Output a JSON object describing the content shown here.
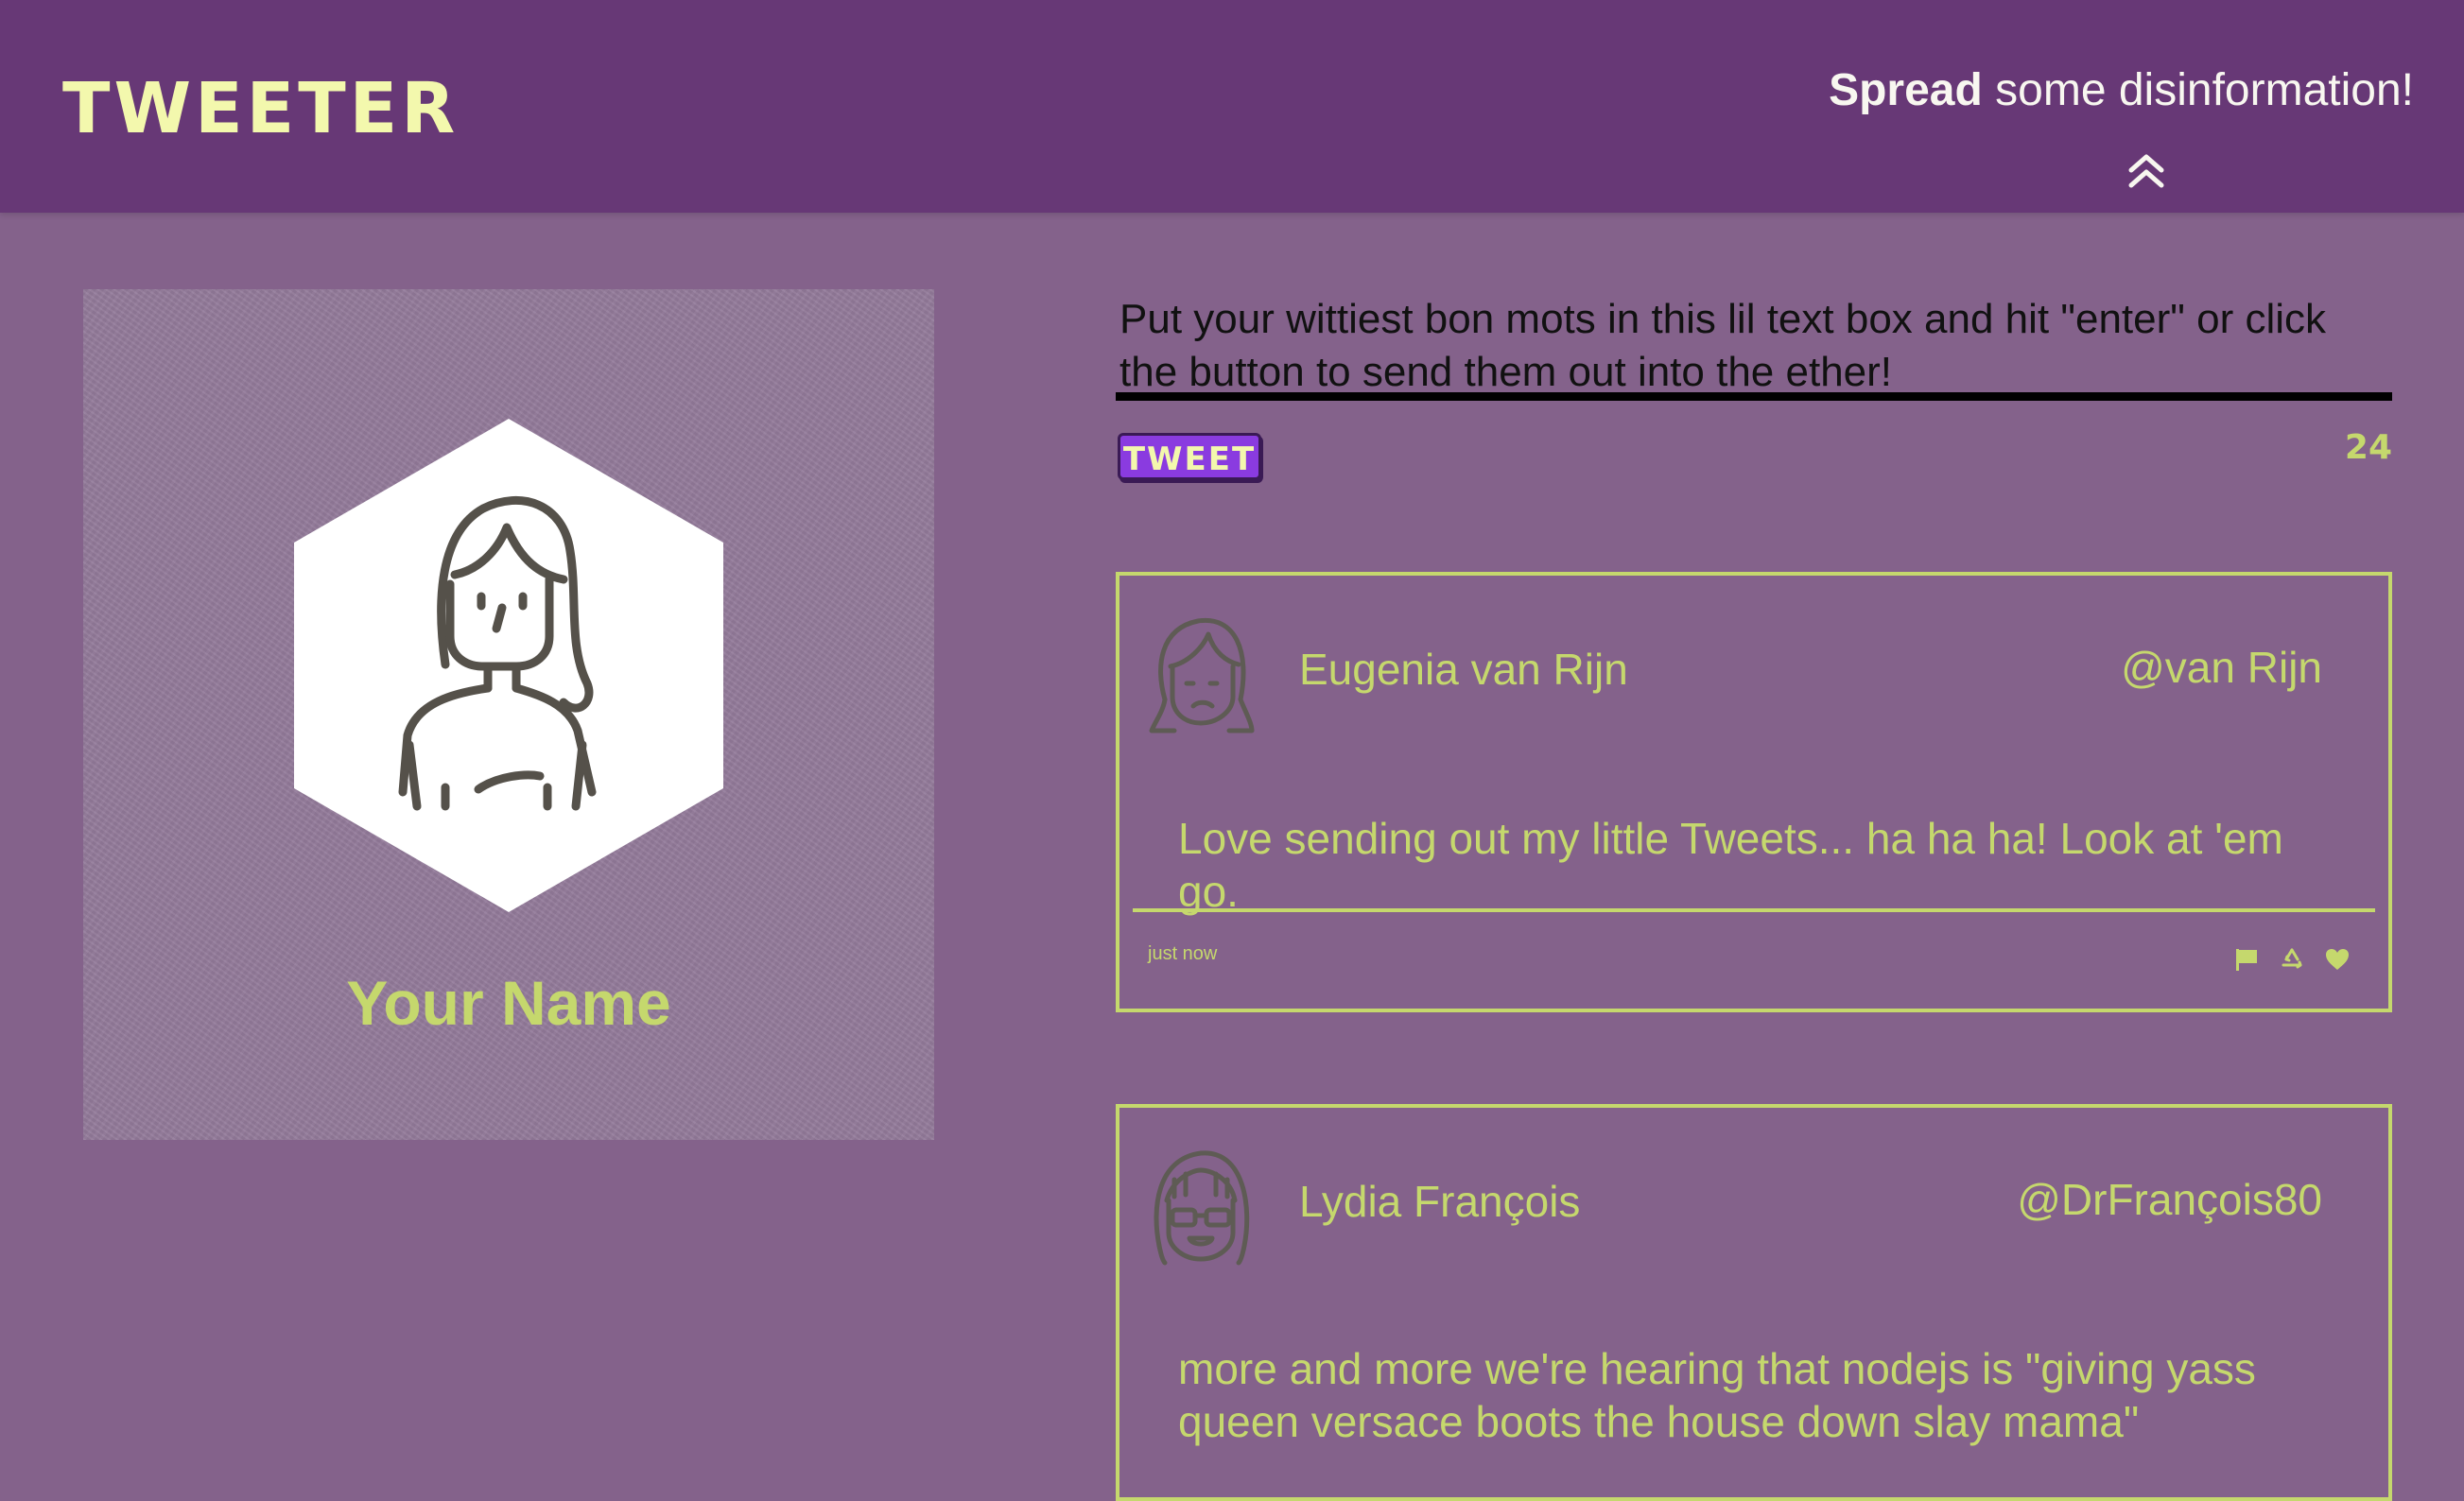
{
  "header": {
    "brand": "TWEETER",
    "cta_bold": "Spread",
    "cta_rest": " some disinformation!",
    "cta_icon": "double-chevron-up-icon"
  },
  "profile": {
    "name": "Your Name",
    "avatar_icon": "woman-avatar-icon"
  },
  "composer": {
    "placeholder": "Put your wittiest bon mots in this lil text box and hit \"enter\" or click the button to send them out into the ether!",
    "value": "",
    "button_label": "TWEET",
    "counter": "24"
  },
  "tweets": [
    {
      "name": "Eugenia van Rijn",
      "handle": "@van Rijn",
      "avatar_icon": "sad-woman-avatar-icon",
      "content": "Love sending out my little Tweets... ha ha ha! Look at 'em go.",
      "time": "just now",
      "actions": [
        "flag-icon",
        "retweet-icon",
        "heart-icon"
      ]
    },
    {
      "name": "Lydia François",
      "handle": "@DrFrançois80",
      "avatar_icon": "sunglasses-woman-avatar-icon",
      "content": "more and more we're hearing that nodejs is \"giving yass queen versace boots the house down slay mama\""
    }
  ],
  "colors": {
    "page_bg": "#84628b",
    "nav_bg": "#673876",
    "accent": "#c5d86d",
    "brand": "#f3f8ad",
    "button_bg": "#8a3be0"
  }
}
